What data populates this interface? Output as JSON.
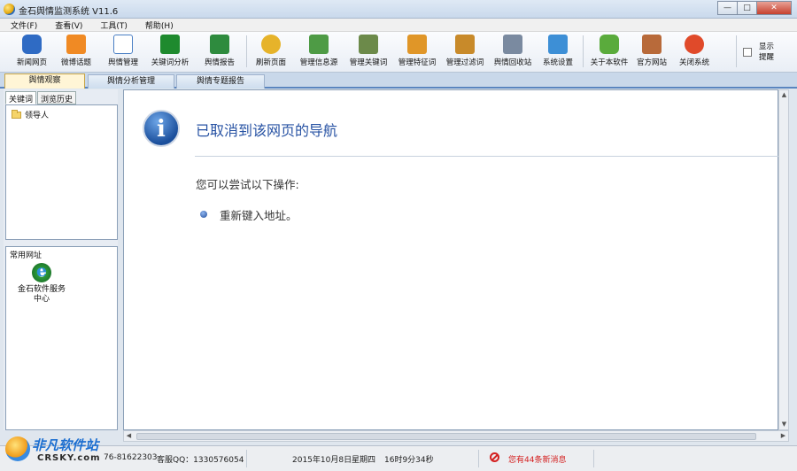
{
  "window": {
    "title": "金石舆情监测系统 V11.6",
    "controls": [
      "—",
      "□",
      "✕"
    ]
  },
  "menu": [
    "文件(F)",
    "查看(V)",
    "工具(T)",
    "帮助(H)"
  ],
  "toolbar": [
    {
      "label": "新闻网页",
      "icon": "news-icon",
      "color": "#2f6bc4"
    },
    {
      "label": "微博话题",
      "icon": "rss-icon",
      "color": "#f08a24"
    },
    {
      "label": "舆情管理",
      "icon": "document-icon",
      "color": "#4a7fc4"
    },
    {
      "label": "关键词分析",
      "icon": "bar-chart-icon",
      "color": "#1e8a2e"
    },
    {
      "label": "舆情报告",
      "icon": "excel-icon",
      "color": "#2e8b3e"
    },
    {
      "label": "刷新页面",
      "icon": "star-refresh-icon",
      "color": "#e6b32a"
    },
    {
      "label": "管理信息源",
      "icon": "database-icon",
      "color": "#4e9b45"
    },
    {
      "label": "管理关键词",
      "icon": "table-icon",
      "color": "#6c8a4a"
    },
    {
      "label": "管理特征词",
      "icon": "tag-icon",
      "color": "#e09628"
    },
    {
      "label": "管理过滤词",
      "icon": "folder-filter-icon",
      "color": "#c88a2a"
    },
    {
      "label": "舆情回收站",
      "icon": "recycle-bin-icon",
      "color": "#7a8aa0"
    },
    {
      "label": "系统设置",
      "icon": "monitor-icon",
      "color": "#3d8fd6"
    },
    {
      "label": "关于本软件",
      "icon": "chat-icon",
      "color": "#5aab3c"
    },
    {
      "label": "官方网站",
      "icon": "home-icon",
      "color": "#b86a3a"
    },
    {
      "label": "关闭系统",
      "icon": "close-icon",
      "color": "#e04a2a"
    }
  ],
  "tip_checkbox": {
    "label": "显示提醒",
    "checked": false
  },
  "tabs": [
    "舆情观察",
    "舆情分析管理",
    "舆情专题报告"
  ],
  "left_panel": {
    "subtabs": [
      "关键词",
      "浏览历史"
    ],
    "tree_items": [
      "领导人"
    ],
    "links_header": "常用网址",
    "links": [
      {
        "label": "金石软件服务中心",
        "icon": "ie-icon"
      }
    ]
  },
  "content": {
    "title": "已取消到该网页的导航",
    "subtitle": "您可以尝试以下操作:",
    "items": [
      "重新键入地址。"
    ]
  },
  "status": {
    "phone": "76-81622303",
    "qq": "客服QQ：1330576054",
    "date": "2015年10月8日",
    "weekday": "星期四",
    "time": "16时9分34秒",
    "message": "您有44条新消息"
  },
  "watermark": {
    "text1": "非凡软件站",
    "text2": "CRSKY.com"
  }
}
